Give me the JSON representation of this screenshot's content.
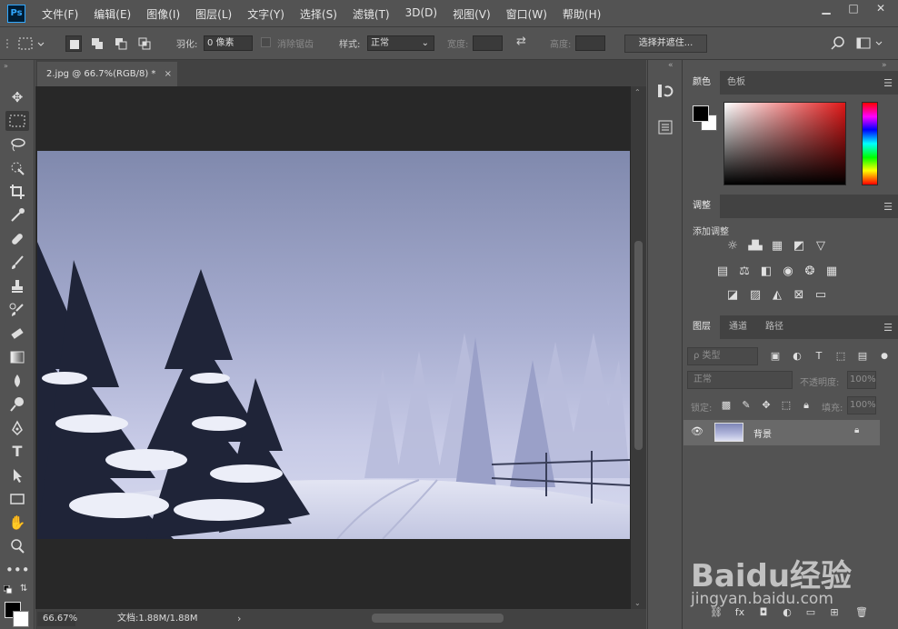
{
  "app": {
    "logo": "Ps"
  },
  "menu": [
    "文件(F)",
    "编辑(E)",
    "图像(I)",
    "图层(L)",
    "文字(Y)",
    "选择(S)",
    "滤镜(T)",
    "3D(D)",
    "视图(V)",
    "窗口(W)",
    "帮助(H)"
  ],
  "window_controls": {
    "minimize": "▁",
    "maximize": "□",
    "close": "✕"
  },
  "options": {
    "feather_label": "羽化:",
    "feather_value": "0 像素",
    "antialias_label": "消除锯齿",
    "style_label": "样式:",
    "style_value": "正常",
    "width_label": "宽度:",
    "height_label": "高度:",
    "select_mask_button": "选择并遮住..."
  },
  "tools": [
    "move-tool",
    "marquee-tool",
    "lasso-tool",
    "quick-select-tool",
    "crop-tool",
    "eyedropper-tool",
    "healing-tool",
    "brush-tool",
    "stamp-tool",
    "history-brush-tool",
    "eraser-tool",
    "gradient-tool",
    "blur-tool",
    "dodge-tool",
    "pen-tool",
    "type-tool",
    "path-select-tool",
    "shape-tool",
    "hand-tool",
    "zoom-tool",
    "more-tools"
  ],
  "document": {
    "tab_title": "2.jpg @ 66.7%(RGB/8) *",
    "tab_close": "×"
  },
  "status": {
    "zoom": "66.67%",
    "doc_size": "文档:1.88M/1.88M",
    "arrow": "›"
  },
  "panels": {
    "color_tabs": [
      "颜色",
      "色板"
    ],
    "adjust_tab": "调整",
    "adjust_title": "添加调整",
    "layer_tabs": [
      "图层",
      "通道",
      "路径"
    ],
    "kind_filter": "ρ 类型",
    "blend_mode": "正常",
    "opacity_label": "不透明度:",
    "opacity_value": "100%",
    "lock_label": "锁定:",
    "fill_label": "填充:",
    "fill_value": "100%",
    "layer_name": "背景"
  },
  "colors": {
    "foreground": "#000000",
    "background": "#ffffff",
    "accent": "#31a8ff"
  },
  "watermark": {
    "brand": "Baidu经验",
    "url": "jingyan.baidu.com"
  }
}
